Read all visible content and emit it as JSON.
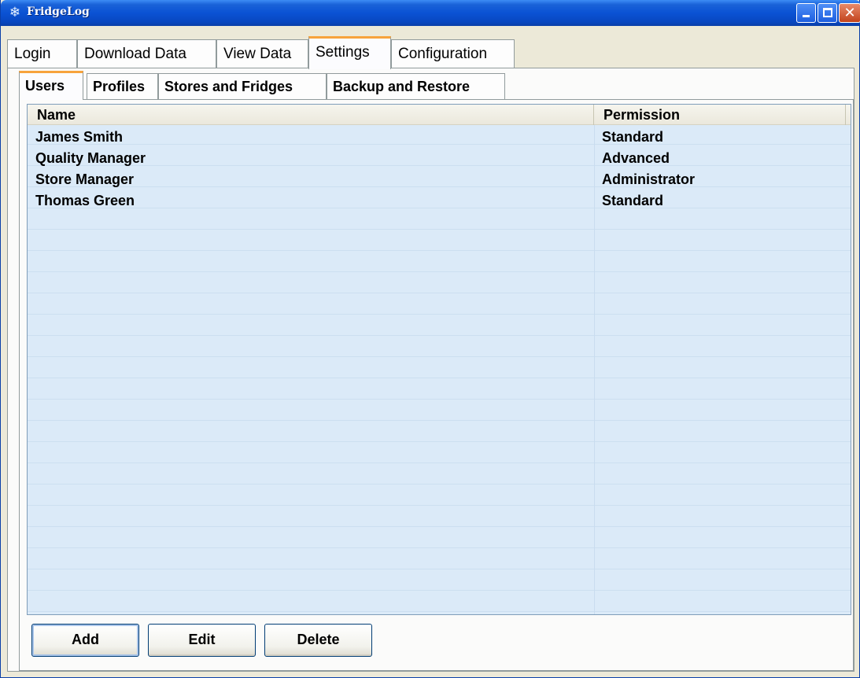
{
  "window": {
    "title": "FridgeLog",
    "icon": "snowflake-icon",
    "controls": [
      "minimize",
      "maximize",
      "close"
    ]
  },
  "main_tabs": [
    {
      "label": "Login",
      "active": false
    },
    {
      "label": "Download Data",
      "active": false
    },
    {
      "label": "View Data",
      "active": false
    },
    {
      "label": "Settings",
      "active": true
    },
    {
      "label": "Configuration",
      "active": false
    }
  ],
  "sub_tabs": [
    {
      "label": "Users",
      "active": true
    },
    {
      "label": "Profiles",
      "active": false
    },
    {
      "label": "Stores and Fridges",
      "active": false
    },
    {
      "label": "Backup and Restore",
      "active": false
    }
  ],
  "users_table": {
    "columns": [
      "Name",
      "Permission"
    ],
    "rows": [
      {
        "name": "James Smith",
        "permission": "Standard"
      },
      {
        "name": "Quality Manager",
        "permission": "Advanced"
      },
      {
        "name": "Store Manager",
        "permission": "Administrator"
      },
      {
        "name": "Thomas Green",
        "permission": "Standard"
      }
    ]
  },
  "buttons": {
    "add": "Add",
    "edit": "Edit",
    "delete": "Delete"
  },
  "colors": {
    "titlebar": "#0a52d4",
    "active_tab_accent": "#f7a33c",
    "table_background": "#dbeaf8"
  }
}
